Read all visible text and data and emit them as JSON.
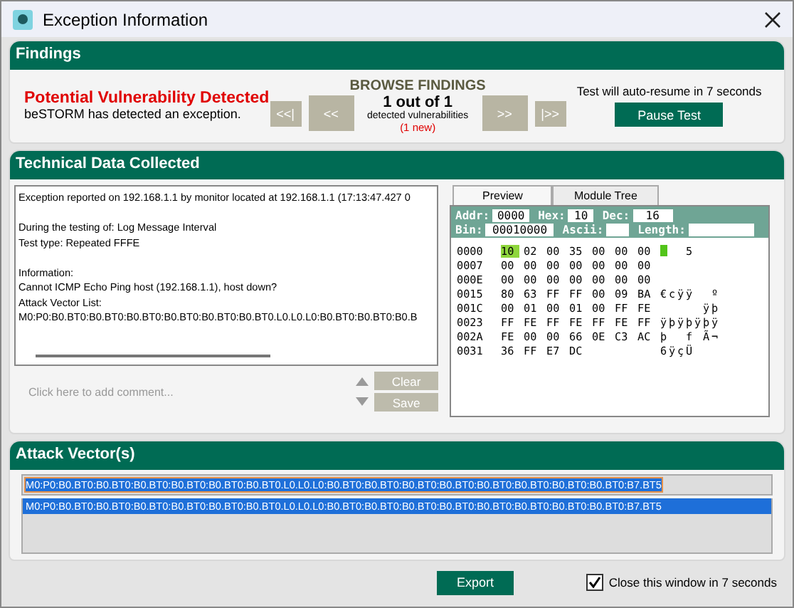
{
  "window": {
    "title": "Exception Information"
  },
  "findings": {
    "title": "Findings",
    "headline": "Potential Vulnerability Detected",
    "subtext": "beSTORM has detected an exception.",
    "browse_title": "BROWSE FINDINGS",
    "nav_buttons": [
      {
        "label": "<<|",
        "kind": "small"
      },
      {
        "label": "<<",
        "kind": "large"
      },
      {
        "label": ">>",
        "kind": "large"
      },
      {
        "label": "|>>",
        "kind": "small"
      }
    ],
    "count": "1 out of 1",
    "count_label": "detected vulnerabilities",
    "new_count": "(1 new)",
    "resume_text": "Test will auto-resume in 7 seconds",
    "pause_button": "Pause Test"
  },
  "technical": {
    "title": "Technical Data Collected",
    "report_paragraphs": [
      [
        "Exception reported on 192.168.1.1 by monitor located at 192.168.1.1 (17:13:47.427 0"
      ],
      [
        "During the testing of: Log Message Interval",
        "Test type: Repeated FFFE"
      ],
      [
        "Information:",
        "Cannot ICMP Echo Ping host (192.168.1.1), host down?",
        "Attack Vector List:",
        "M0:P0:B0.BT0:B0.BT0:B0.BT0:B0.BT0:B0.BT0:B0.BT0.L0.L0.L0:B0.BT0:B0.BT0:B0.B"
      ]
    ],
    "comment": {
      "placeholder": "Click here to add comment..."
    },
    "buttons": [
      {
        "label": "Clear",
        "disabled": true
      },
      {
        "label": "Save",
        "disabled": true
      }
    ],
    "tabs": [
      {
        "label": "Preview",
        "selected": true
      },
      {
        "label": "Module Tree",
        "selected": false
      }
    ],
    "fields": [
      {
        "label": "Addr:",
        "value": "0000"
      },
      {
        "label": "Hex:",
        "value": "10"
      },
      {
        "label": "Dec:",
        "value": "16"
      },
      {
        "label": "Bin:",
        "value": "00010000"
      },
      {
        "label": "Ascii:"
      },
      {
        "label": "Length:"
      }
    ],
    "hex_rows": [
      {
        "address": "0000",
        "bytes": [
          {
            "hex": "10",
            "selected": true
          },
          {
            "hex": "02",
            "selected": false
          },
          {
            "hex": "00",
            "selected": false
          },
          {
            "hex": "35",
            "ascii": "5",
            "selected": false
          },
          {
            "hex": "00",
            "selected": false
          },
          {
            "hex": "00",
            "selected": false
          },
          {
            "hex": "00",
            "selected": false
          }
        ]
      },
      {
        "address": "0007",
        "bytes": [
          {
            "hex": "00",
            "selected": false
          },
          {
            "hex": "00",
            "selected": false
          },
          {
            "hex": "00",
            "selected": false
          },
          {
            "hex": "00",
            "selected": false
          },
          {
            "hex": "00",
            "selected": false
          },
          {
            "hex": "00",
            "selected": false
          },
          {
            "hex": "00",
            "selected": false
          }
        ]
      },
      {
        "address": "000E",
        "bytes": [
          {
            "hex": "00",
            "selected": false
          },
          {
            "hex": "00",
            "selected": false
          },
          {
            "hex": "00",
            "selected": false
          },
          {
            "hex": "00",
            "selected": false
          },
          {
            "hex": "00",
            "selected": false
          },
          {
            "hex": "00",
            "selected": false
          },
          {
            "hex": "00",
            "selected": false
          }
        ]
      },
      {
        "address": "0015",
        "bytes": [
          {
            "hex": "80",
            "ascii": "€",
            "selected": false
          },
          {
            "hex": "63",
            "ascii": "c",
            "selected": false
          },
          {
            "hex": "FF",
            "ascii": "ÿ",
            "selected": false
          },
          {
            "hex": "FF",
            "ascii": "ÿ",
            "selected": false
          },
          {
            "hex": "00",
            "selected": false
          },
          {
            "hex": "09",
            "selected": false
          },
          {
            "hex": "BA",
            "ascii": "º",
            "selected": false
          }
        ]
      },
      {
        "address": "001C",
        "bytes": [
          {
            "hex": "00",
            "selected": false
          },
          {
            "hex": "01",
            "selected": false
          },
          {
            "hex": "00",
            "selected": false
          },
          {
            "hex": "01",
            "selected": false
          },
          {
            "hex": "00",
            "selected": false
          },
          {
            "hex": "FF",
            "ascii": "ÿ",
            "selected": false
          },
          {
            "hex": "FE",
            "ascii": "þ",
            "selected": false
          }
        ]
      },
      {
        "address": "0023",
        "bytes": [
          {
            "hex": "FF",
            "ascii": "ÿ",
            "selected": false
          },
          {
            "hex": "FE",
            "ascii": "þ",
            "selected": false
          },
          {
            "hex": "FF",
            "ascii": "ÿ",
            "selected": false
          },
          {
            "hex": "FE",
            "ascii": "þ",
            "selected": false
          },
          {
            "hex": "FF",
            "ascii": "ÿ",
            "selected": false
          },
          {
            "hex": "FE",
            "ascii": "þ",
            "selected": false
          },
          {
            "hex": "FF",
            "ascii": "ÿ",
            "selected": false
          }
        ]
      },
      {
        "address": "002A",
        "bytes": [
          {
            "hex": "FE",
            "ascii": "þ",
            "selected": false
          },
          {
            "hex": "00",
            "selected": false
          },
          {
            "hex": "00",
            "selected": false
          },
          {
            "hex": "66",
            "ascii": "f",
            "selected": false
          },
          {
            "hex": "0E",
            "selected": false
          },
          {
            "hex": "C3",
            "ascii": "Ã",
            "selected": false
          },
          {
            "hex": "AC",
            "ascii": "¬",
            "selected": false
          }
        ]
      },
      {
        "address": "0031",
        "bytes": [
          {
            "hex": "36",
            "ascii": "6",
            "selected": false
          },
          {
            "hex": "FF",
            "ascii": "ÿ",
            "selected": false
          },
          {
            "hex": "E7",
            "ascii": "ç",
            "selected": false
          },
          {
            "hex": "DC",
            "ascii": "Ü",
            "selected": false
          }
        ]
      }
    ]
  },
  "attack_vectors": {
    "title": "Attack Vector(s)",
    "value": "M0:P0:B0.BT0:B0.BT0:B0.BT0:B0.BT0:B0.BT0:B0.BT0.L0.L0.L0:B0.BT0:B0.BT0:B0.BT0:B0.BT0:B0.BT0:B0.BT0:B0.BT0:B0.BT0:B7.BT5",
    "items": [
      {
        "label": "M0:P0:B0.BT0:B0.BT0:B0.BT0:B0.BT0:B0.BT0:B0.BT0.L0.L0.L0:B0.BT0:B0.BT0:B0.BT0:B0.BT0:B0.BT0:B0.BT0:B0.BT0:B0.BT0:B7.BT5",
        "selected": true
      }
    ]
  },
  "footer": {
    "export_button": "Export",
    "close_option": {
      "label": "Close this window in 7 seconds",
      "checked": true
    }
  }
}
